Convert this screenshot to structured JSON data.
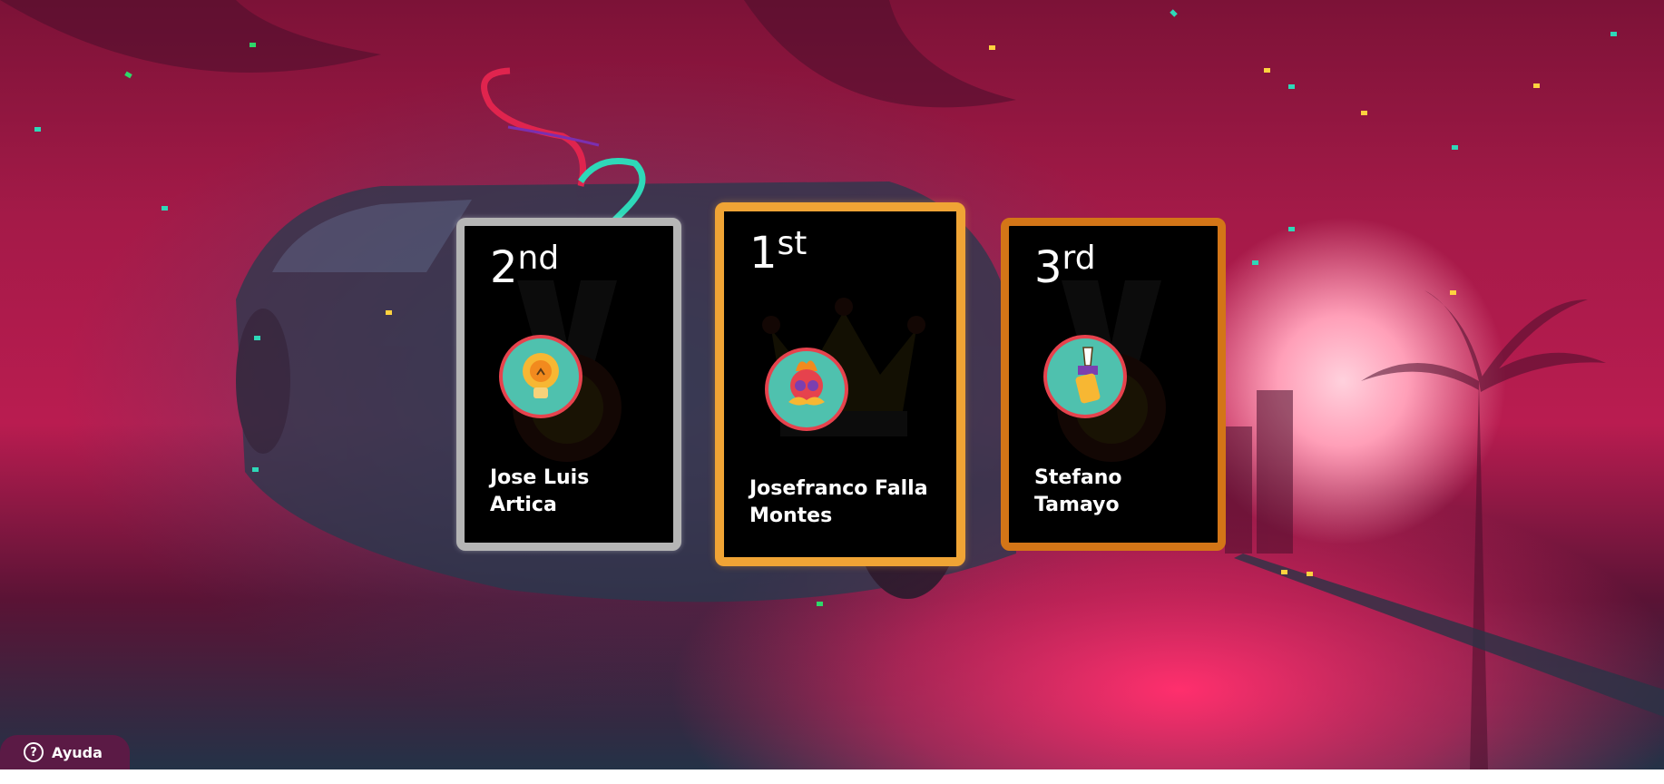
{
  "podium": [
    {
      "place_number": "2",
      "place_suffix": "nd",
      "name_line1": "Jose Luis",
      "name_line2": "Artica",
      "frame_color": "#b5b5b5",
      "avatar_icon": "lightbulb-icon"
    },
    {
      "place_number": "1",
      "place_suffix": "st",
      "name_line1": "Josefranco Falla",
      "name_line2": "Montes",
      "frame_color": "#f0a435",
      "avatar_icon": "skull-mustache-icon"
    },
    {
      "place_number": "3",
      "place_suffix": "rd",
      "name_line1": "Stefano",
      "name_line2": "Tamayo",
      "frame_color": "#d37517",
      "avatar_icon": "fountain-pen-icon"
    }
  ],
  "help": {
    "label": "Ayuda",
    "icon": "help-circle-icon"
  },
  "colors": {
    "background_accent": "#b91c50",
    "help_button": "#5b1a45",
    "badge_fill": "#4fc1ae",
    "badge_ring": "#e6424d"
  }
}
